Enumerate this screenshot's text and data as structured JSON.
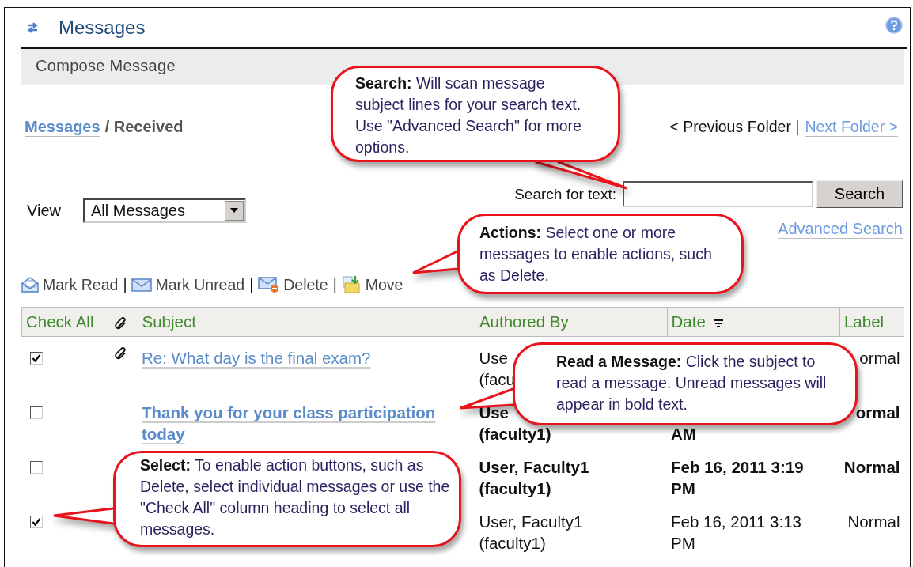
{
  "header": {
    "title": "Messages"
  },
  "toolbar": {
    "compose": "Compose Message"
  },
  "breadcrumb": {
    "link": "Messages",
    "current": "/ Received"
  },
  "folder_nav": {
    "previous": "< Previous Folder |",
    "next": "Next Folder >"
  },
  "search": {
    "label": "Search for text:",
    "button": "Search",
    "advanced": "Advanced Search"
  },
  "view": {
    "label": "View",
    "value": "All Messages"
  },
  "actions": [
    {
      "kind": "read",
      "label": "Mark Read",
      "separator": "|"
    },
    {
      "kind": "unread",
      "label": "Mark Unread",
      "separator": "|"
    },
    {
      "kind": "delete",
      "label": "Delete",
      "separator": "|"
    },
    {
      "kind": "move",
      "label": "Move"
    }
  ],
  "table": {
    "columns": [
      {
        "kind": "check",
        "label": "Check All"
      },
      {
        "kind": "attachment"
      },
      {
        "kind": "text",
        "label": "Subject"
      },
      {
        "kind": "text",
        "label": "Authored By"
      },
      {
        "kind": "sorted",
        "label": "Date"
      },
      {
        "kind": "text",
        "label": "Label"
      }
    ],
    "rows": [
      {
        "checked": true,
        "attachment": true,
        "unread": false,
        "subject": "Re: What day is the final exam?",
        "author": "Use\n(facu",
        "label": "ormal"
      },
      {
        "checked": false,
        "attachment": false,
        "unread": true,
        "subject": "Thank you for your class participation today",
        "author": "Use\n(faculty1)",
        "date": "AM",
        "label": "ormal"
      },
      {
        "checked": false,
        "attachment": false,
        "unread": true,
        "author": "User, Faculty1\n(faculty1)",
        "date": "Feb 16, 2011 3:19\nPM",
        "label": "Normal"
      },
      {
        "checked": true,
        "attachment": false,
        "unread": false,
        "author": "User, Faculty1\n(faculty1)",
        "date": "Feb 16, 2011 3:13\nPM",
        "label": "Normal"
      }
    ]
  },
  "callouts": [
    {
      "text": "**Search:** Will scan message subject lines for your search text. Use \"Advanced Search\" for more options."
    },
    {
      "text": "**Actions:** Select one or more messages to enable actions, such as Delete."
    },
    {
      "text": "**Read a Message:** Click the subject to read a message. Unread messages will appear in bold text."
    },
    {
      "text": "**Select:** To enable action buttons, such as Delete, select individual messages or use the \"Check All\" column heading to select all messages."
    }
  ]
}
